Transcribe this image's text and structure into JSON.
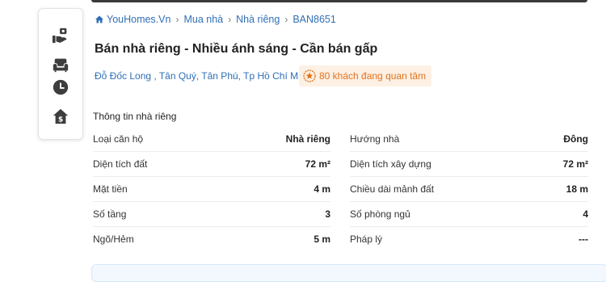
{
  "breadcrumb": {
    "items": [
      "YouHomes.Vn",
      "Mua nhà",
      "Nhà riêng",
      "BAN8651"
    ]
  },
  "listing": {
    "title": "Bán nhà riêng - Nhiều ánh sáng - Cần bán gấp",
    "address": "Đỗ Đốc Long , Tân Quý, Tân Phú, Tp Hồ Chí Minh",
    "interest_badge": "80 khách đang quan tâm"
  },
  "specs": {
    "section_title": "Thông tin nhà riêng",
    "left": [
      {
        "label": "Loại căn hộ",
        "value": "Nhà riêng"
      },
      {
        "label": "Diện tích đất",
        "value": "72 m²"
      },
      {
        "label": "Mặt tiền",
        "value": "4 m"
      },
      {
        "label": "Số tầng",
        "value": "3"
      },
      {
        "label": "Ngõ/Hẻm",
        "value": "5 m"
      }
    ],
    "right": [
      {
        "label": "Hướng nhà",
        "value": "Đông"
      },
      {
        "label": "Diện tích xây dựng",
        "value": "72 m²"
      },
      {
        "label": "Chiều dài mảnh đất",
        "value": "18 m"
      },
      {
        "label": "Số phòng ngủ",
        "value": "4"
      },
      {
        "label": "Pháp lý",
        "value": "---"
      }
    ]
  },
  "toolbar": {
    "icons": [
      "hand-money-icon",
      "armchair-icon",
      "clock-icon",
      "house-dollar-icon"
    ]
  },
  "colors": {
    "link": "#2f6fb5",
    "badge_text": "#e3731b",
    "badge_bg": "#fdf0e4"
  }
}
